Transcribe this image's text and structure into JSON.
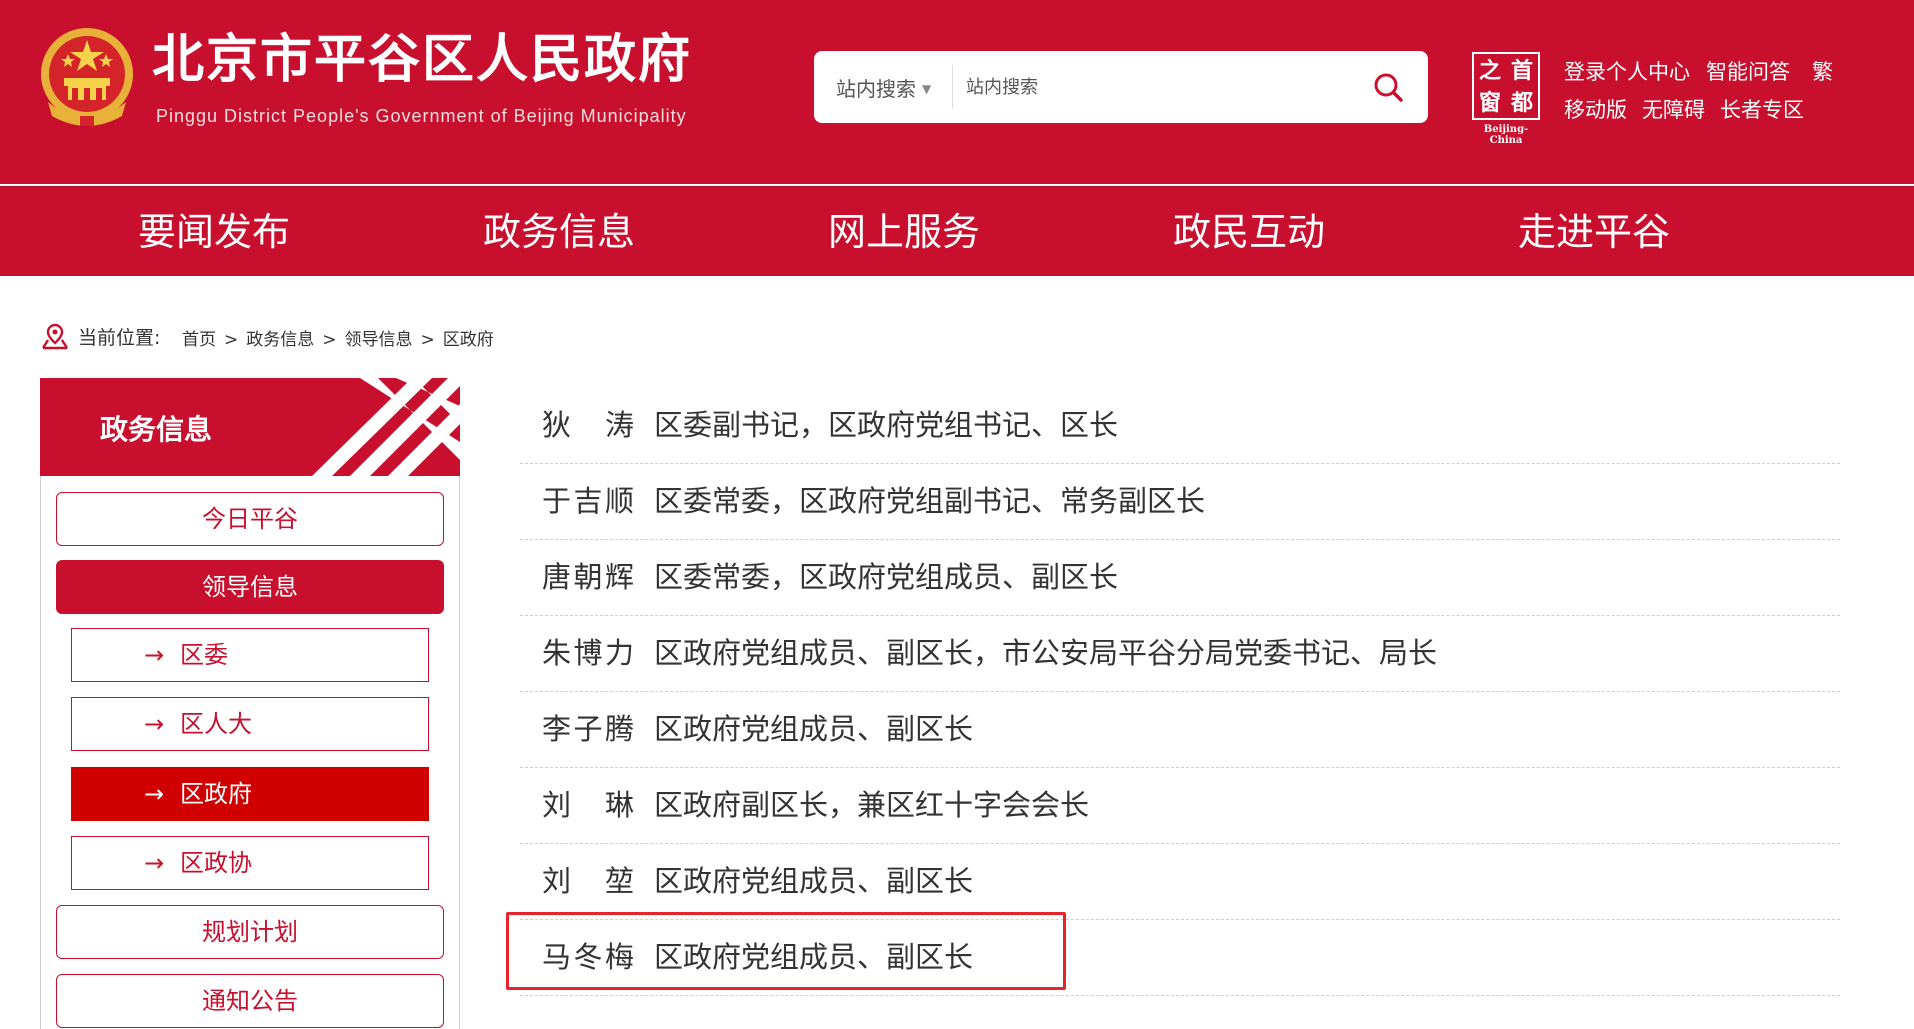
{
  "header": {
    "site_title": "北京市平谷区人民政府",
    "site_subtitle": "Pinggu District People's Government of Beijing Municipality",
    "search": {
      "scope_label": "站内搜索",
      "placeholder": "站内搜索"
    },
    "capital_logo": {
      "chars": [
        "之",
        "首",
        "窗",
        "都"
      ],
      "caption": "Beijing-China"
    },
    "links": [
      "登录个人中心",
      "智能问答",
      "繁",
      "移动版",
      "无障碍",
      "长者专区"
    ]
  },
  "nav": {
    "items": [
      "要闻发布",
      "政务信息",
      "网上服务",
      "政民互动",
      "走进平谷"
    ]
  },
  "breadcrumb": {
    "label": "当前位置:",
    "crumbs": [
      "首页",
      "政务信息",
      "领导信息",
      "区政府"
    ],
    "separator": ">"
  },
  "sidebar": {
    "title": "政务信息",
    "items": [
      {
        "label": "今日平谷",
        "state": "normal"
      },
      {
        "label": "领导信息",
        "state": "active"
      }
    ],
    "sub_items": [
      {
        "arrow": "→",
        "label": "区委",
        "state": "normal"
      },
      {
        "arrow": "→",
        "label": "区人大",
        "state": "normal"
      },
      {
        "arrow": "→",
        "label": "区政府",
        "state": "active"
      },
      {
        "arrow": "→",
        "label": "区政协",
        "state": "normal"
      }
    ],
    "items_after": [
      {
        "label": "规划计划",
        "state": "normal"
      },
      {
        "label": "通知公告",
        "state": "normal"
      }
    ]
  },
  "leaders": [
    {
      "name": "狄涛",
      "title": "区委副书记，区政府党组书记、区长"
    },
    {
      "name": "于吉顺",
      "title": "区委常委，区政府党组副书记、常务副区长"
    },
    {
      "name": "唐朝辉",
      "title": "区委常委，区政府党组成员、副区长"
    },
    {
      "name": "朱博力",
      "title": "区政府党组成员、副区长，市公安局平谷分局党委书记、局长"
    },
    {
      "name": "李子腾",
      "title": "区政府党组成员、副区长"
    },
    {
      "name": "刘琳",
      "title": "区政府副区长，兼区红十字会会长"
    },
    {
      "name": "刘堃",
      "title": "区政府党组成员、副区长"
    },
    {
      "name": "马冬梅",
      "title": "区政府党组成员、副区长"
    }
  ],
  "highlighted_leader_index": 7,
  "colors": {
    "brand_red": "#c8102e",
    "active_red": "#d10000",
    "highlight_border": "#e8232a"
  }
}
